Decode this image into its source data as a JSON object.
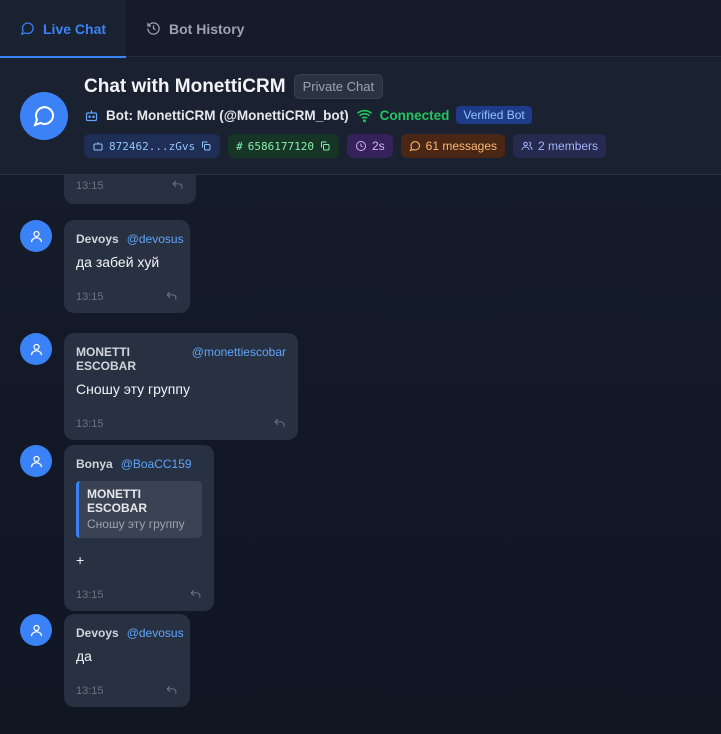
{
  "tabs": [
    {
      "label": "Live Chat",
      "icon": "chat-bubble-icon",
      "active": true
    },
    {
      "label": "Bot History",
      "icon": "history-icon",
      "active": false
    }
  ],
  "header": {
    "title": "Chat with MonettiCRM",
    "chat_type": "Private Chat",
    "bot_label": "Bot: MonettiCRM (@MonettiCRM_bot)",
    "status": "Connected",
    "verified": "Verified Bot",
    "chips": {
      "token": "872462...zGvs",
      "chat_id": "6586177120",
      "latency": "2s",
      "messages": "61 messages",
      "members": "2 members"
    }
  },
  "messages": [
    {
      "time": "13:15"
    },
    {
      "name": "Devoys",
      "handle": "@devosus",
      "text": "да забей хуй",
      "time": "13:15"
    },
    {
      "name": "MONETTI ESCOBAR",
      "handle": "@monettiescobar",
      "text": "Сношу эту группу",
      "time": "13:15"
    },
    {
      "name": "Bonya",
      "handle": "@BoaCC159",
      "quote_name": "MONETTI ESCOBAR",
      "quote_text": "Сношу эту группу",
      "text": "+",
      "time": "13:15"
    },
    {
      "name": "Devoys",
      "handle": "@devosus",
      "text": "да",
      "time": "13:15"
    }
  ],
  "colors": {
    "accent": "#3b82f6",
    "connected": "#22c55e",
    "bubble": "#283142"
  }
}
